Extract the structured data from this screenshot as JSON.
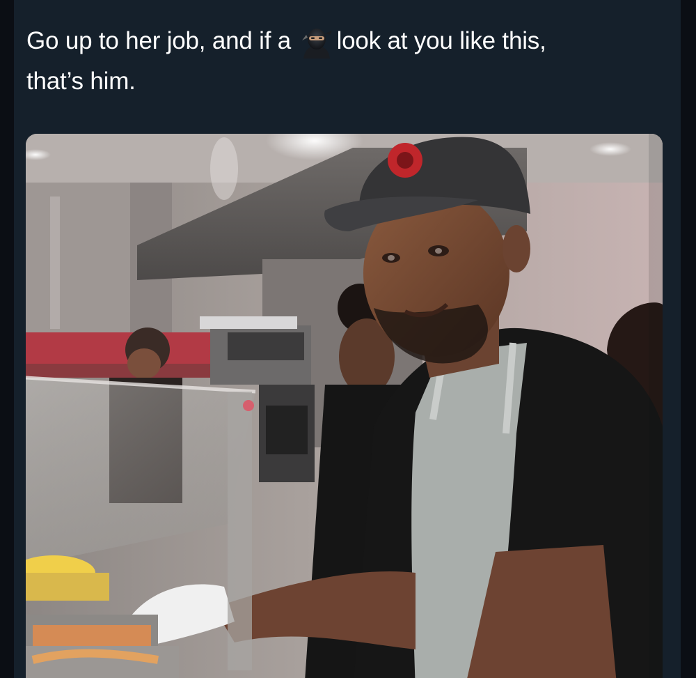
{
  "tweet": {
    "text_line1_before": "Go up to her job, and if a",
    "emoji": "ninja-emoji",
    "text_line1_after": "look at you like this,",
    "text_line2": "that’s him."
  },
  "media": {
    "description_icon": "photo"
  },
  "colors": {
    "background": "#15202b",
    "text": "#ffffff"
  }
}
